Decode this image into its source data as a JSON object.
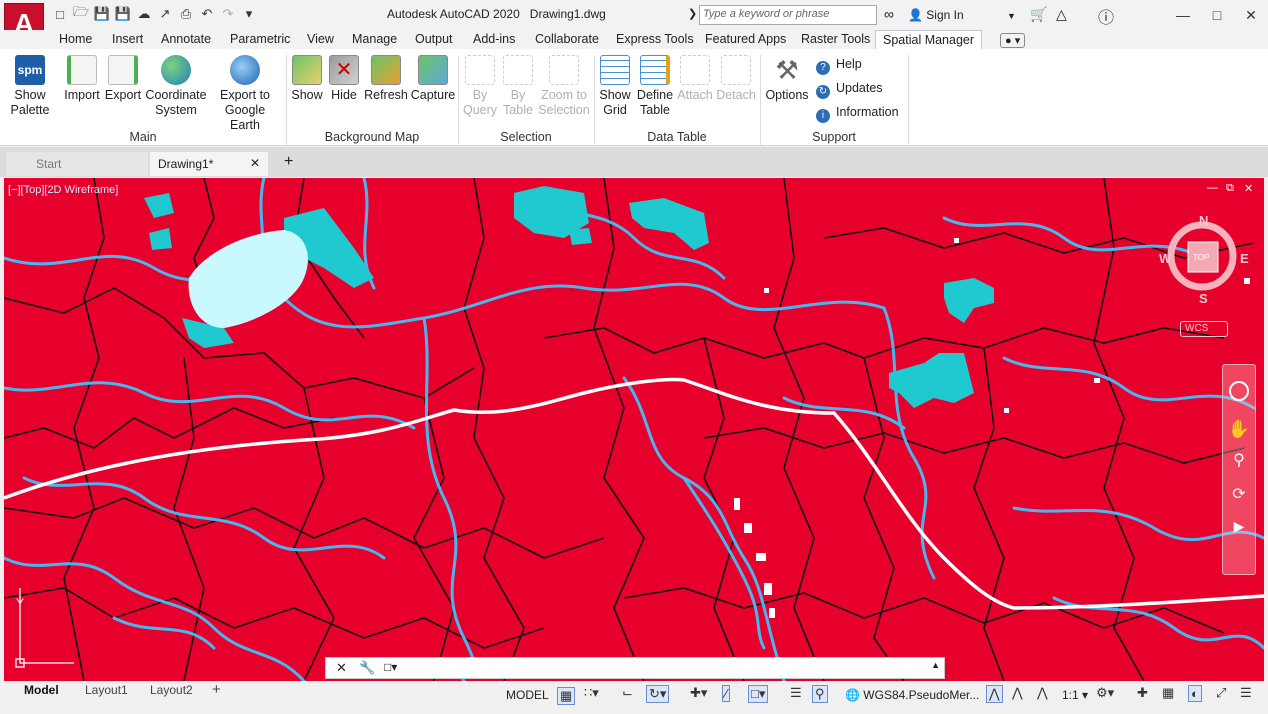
{
  "app": {
    "logo_letter": "A",
    "title": "Autodesk AutoCAD 2020",
    "document": "Drawing1.dwg",
    "search_placeholder": "Type a keyword or phrase",
    "signin": "Sign In"
  },
  "ribbon_tabs": [
    "Home",
    "Insert",
    "Annotate",
    "Parametric",
    "View",
    "Manage",
    "Output",
    "Add-ins",
    "Collaborate",
    "Express Tools",
    "Featured Apps",
    "Raster Tools",
    "Spatial Manager"
  ],
  "ribbon": {
    "main": {
      "title": "Main",
      "spm_logo": "spm",
      "show_palette": [
        "Show",
        "Palette"
      ],
      "import": "Import",
      "export": "Export",
      "coordinate_system": [
        "Coordinate",
        "System"
      ],
      "export_ge": [
        "Export to",
        "Google Earth"
      ]
    },
    "background_map": {
      "title": "Background Map",
      "show": "Show",
      "hide": "Hide",
      "refresh": "Refresh",
      "capture": "Capture"
    },
    "selection": {
      "title": "Selection",
      "by_query": [
        "By",
        "Query"
      ],
      "by_table": [
        "By",
        "Table"
      ],
      "zoom_to": [
        "Zoom to",
        "Selection"
      ]
    },
    "data_table": {
      "title": "Data Table",
      "show_grid": [
        "Show",
        "Grid"
      ],
      "define_table": [
        "Define",
        "Table"
      ],
      "attach": "Attach",
      "detach": "Detach"
    },
    "support": {
      "title": "Support",
      "options": "Options",
      "help": "Help",
      "updates": "Updates",
      "information": "Information"
    }
  },
  "doc_tabs": {
    "start": "Start",
    "drawing": "Drawing1*"
  },
  "viewport": {
    "label": "[−][Top][2D Wireframe]",
    "compass": {
      "n": "N",
      "s": "S",
      "e": "E",
      "w": "W",
      "top": "TOP",
      "wcs": "WCS"
    },
    "ucs_y": "Y"
  },
  "layout_tabs": [
    "Model",
    "Layout1",
    "Layout2"
  ],
  "status": {
    "model": "MODEL",
    "coord_system": "WGS84.PseudoMer...",
    "scale": "1:1"
  },
  "colors": {
    "background": "#e8002c",
    "water": "#20c9d0",
    "lake": "#c9f9ff",
    "river": "#4ab6ef",
    "road": "#ffffff",
    "boundary": "#111111"
  }
}
